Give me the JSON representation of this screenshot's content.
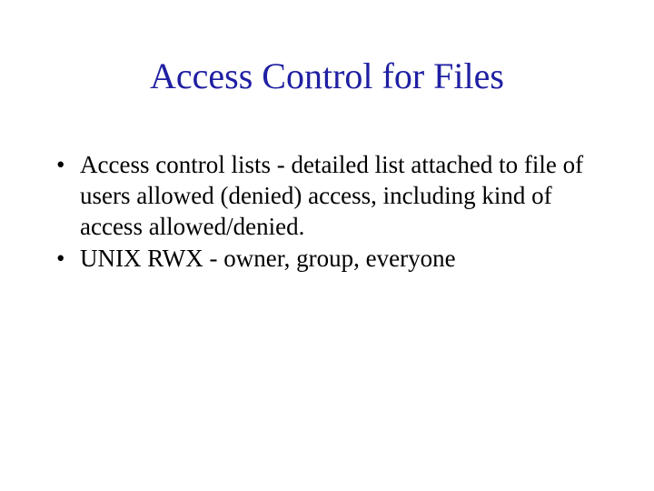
{
  "title": "Access Control for Files",
  "bullets": [
    "Access control lists - detailed list attached to file of users allowed (denied) access, including kind of access allowed/denied.",
    "UNIX RWX - owner, group, everyone"
  ]
}
